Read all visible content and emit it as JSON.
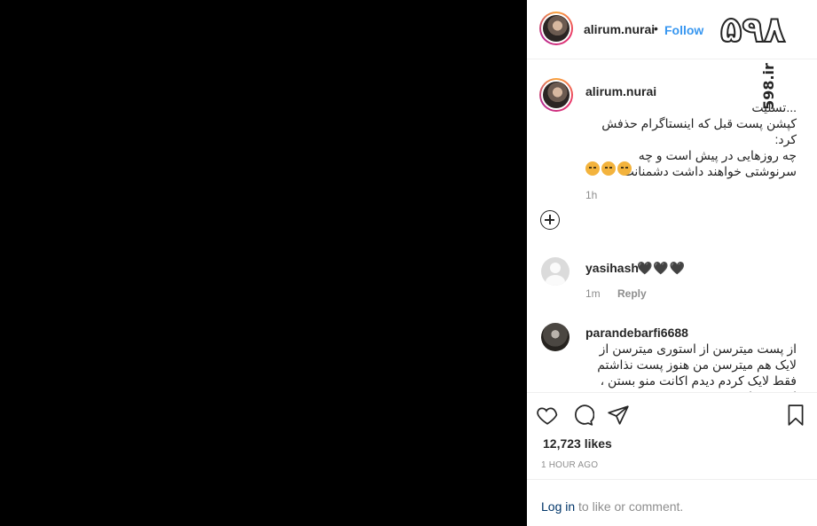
{
  "header": {
    "username": "alirum.nurai",
    "separator": "•",
    "follow_label": "Follow"
  },
  "watermark": {
    "logo_text": "۵۹۸",
    "site_text": "598.ir"
  },
  "caption": {
    "username": "alirum.nurai",
    "text": "...تسلیت\nکپشن پست قبل که اینستاگرام حذفش کرد:\nچه روزهایی در پیش است و چه سرنوشتی خواهند داشت دشمنانت",
    "emoji_count": 3,
    "time": "1h"
  },
  "comments": [
    {
      "username": "yasihash",
      "text": "🖤🖤🖤",
      "time": "1m",
      "reply_label": "Reply"
    },
    {
      "username": "parandebarfi6688",
      "text": "از پست میترسن از استوری میترسن از لایک هم میترسن من هنوز پست نذاشتم فقط لایک کردم دیدم اکانت منو بستن ، اینقدر رذل و پستن ،"
    }
  ],
  "post": {
    "likes": "12,723 likes",
    "time_ago": "1 HOUR AGO"
  },
  "footer": {
    "login_link": "Log in",
    "login_rest": " to like or comment."
  },
  "colors": {
    "accent": "#3897f0",
    "text": "#262626",
    "muted": "#8e8e8e",
    "media_bg": "#000000"
  }
}
